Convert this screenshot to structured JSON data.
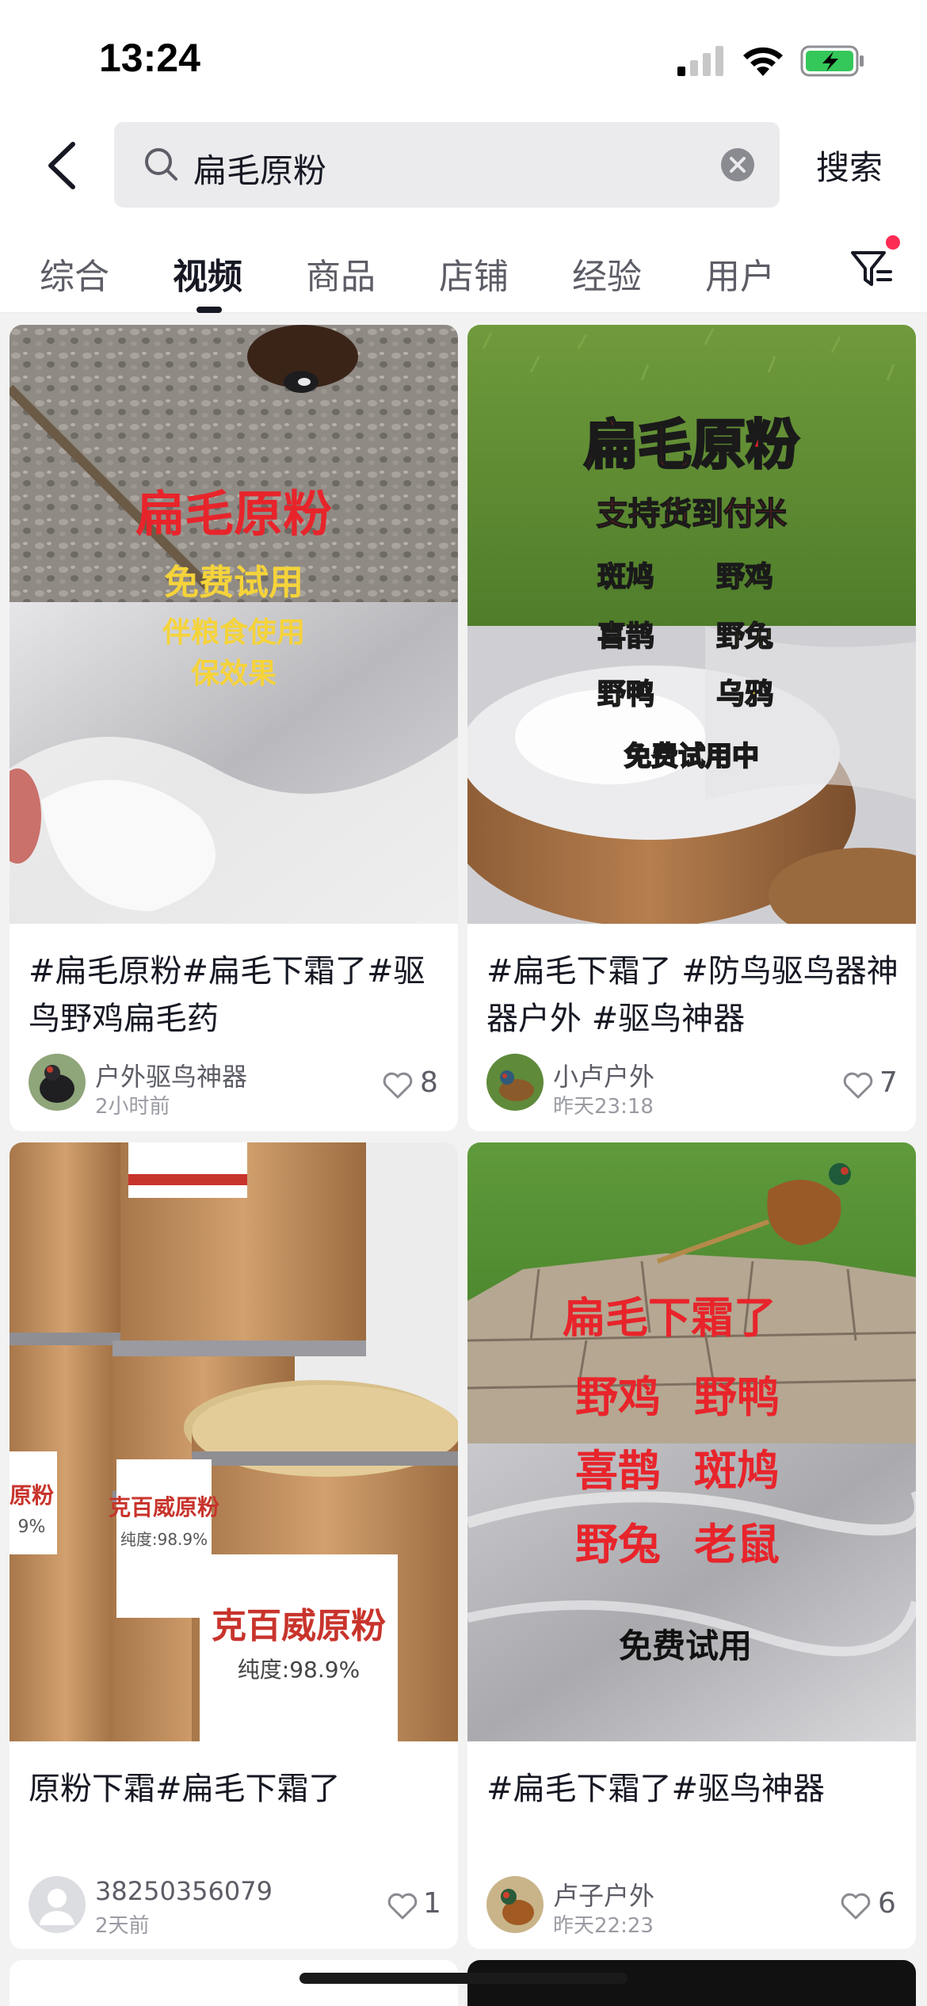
{
  "status_bar": {
    "time": "13:24"
  },
  "search": {
    "query": "扁毛原粉",
    "submit_label": "搜索"
  },
  "tabs": [
    {
      "label": "综合",
      "active": false
    },
    {
      "label": "视频",
      "active": true
    },
    {
      "label": "商品",
      "active": false
    },
    {
      "label": "店铺",
      "active": false
    },
    {
      "label": "经验",
      "active": false
    },
    {
      "label": "用户",
      "active": false
    }
  ],
  "cards": [
    {
      "title": "#扁毛原粉#扁毛下霜了#驱鸟野鸡扁毛药",
      "author": "户外驱鸟神器",
      "time": "2小时前",
      "likes": "8",
      "overlay": [
        "扁毛原粉",
        "免费试用",
        "伴粮食使用",
        "保效果"
      ]
    },
    {
      "title": "#扁毛下霜了 #防鸟驱鸟器神器户外 #驱鸟神器",
      "author": "小卢户外",
      "time": "昨天23:18",
      "likes": "7",
      "overlay": [
        "扁毛原粉",
        "支持货到付米",
        "斑鸠",
        "野鸡",
        "喜鹊",
        "野兔",
        "野鸭",
        "乌鸦",
        "免费试用中"
      ]
    },
    {
      "title": "原粉下霜#扁毛下霜了",
      "author": "38250356079",
      "time": "2天前",
      "likes": "1",
      "overlay": [
        "克百威原粉",
        "纯度:98.9%",
        "克百威原粉",
        "纯度:98.9%",
        "原粉",
        "9%"
      ]
    },
    {
      "title": "#扁毛下霜了#驱鸟神器",
      "author": "卢子户外",
      "time": "昨天22:23",
      "likes": "6",
      "overlay": [
        "扁毛下霜了",
        "野鸡",
        "野鸭",
        "喜鹊",
        "斑鸠",
        "野兔",
        "老鼠",
        "免费试用"
      ]
    }
  ],
  "colors": {
    "accent_red": "#fe2c55",
    "overlay_red": "#e8242b",
    "overlay_yellow": "#f5d33a"
  }
}
